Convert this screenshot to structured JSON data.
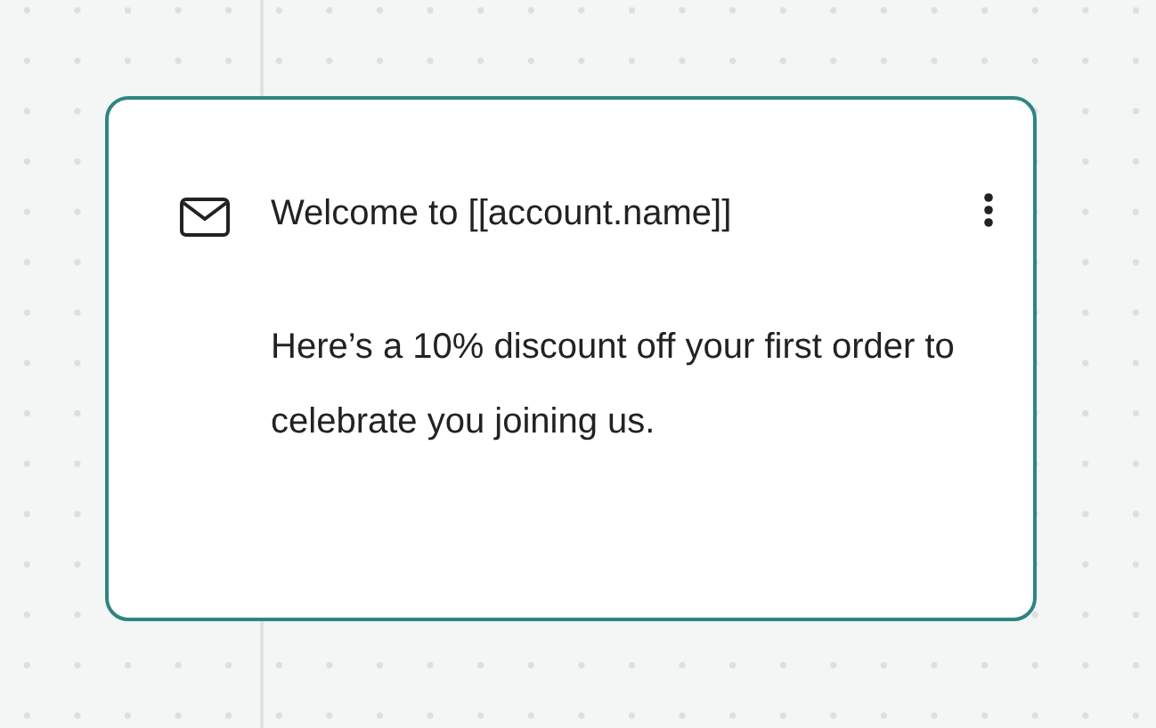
{
  "card": {
    "title": "Welcome to [[account.name]]",
    "body": "Here’s a 10% discount off your first order to celebrate you joining us."
  }
}
